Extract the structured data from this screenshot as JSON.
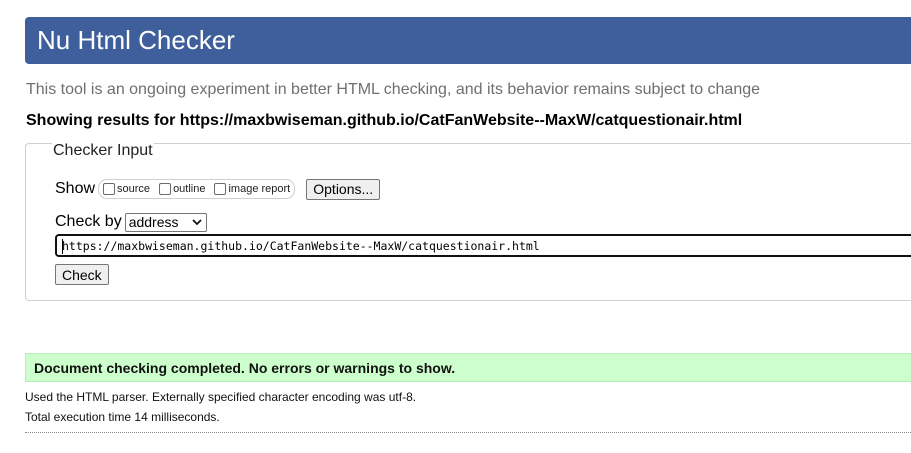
{
  "header": {
    "title": "Nu Html Checker"
  },
  "intro": "This tool is an ongoing experiment in better HTML checking, and its behavior remains subject to change",
  "results_for": "Showing results for https://maxbwiseman.github.io/CatFanWebsite--MaxW/catquestionair.html",
  "checker_input": {
    "legend": "Checker Input",
    "show_label": "Show",
    "show_options": [
      {
        "label": "source",
        "checked": false
      },
      {
        "label": "outline",
        "checked": false
      },
      {
        "label": "image report",
        "checked": false
      }
    ],
    "options_button": "Options...",
    "check_by_label": "Check by",
    "check_by_value": "address",
    "url_value": "https://maxbwiseman.github.io/CatFanWebsite--MaxW/catquestionair.html",
    "check_button": "Check"
  },
  "result": {
    "success_message": "Document checking completed. No errors or warnings to show.",
    "parser_note": "Used the HTML parser. Externally specified character encoding was utf-8.",
    "time_note": "Total execution time 14 milliseconds."
  },
  "colors": {
    "header_bg": "#3e5f9b",
    "success_bg": "#ccffcc"
  },
  "icons": {
    "select_arrow": "chevron-down-icon"
  }
}
